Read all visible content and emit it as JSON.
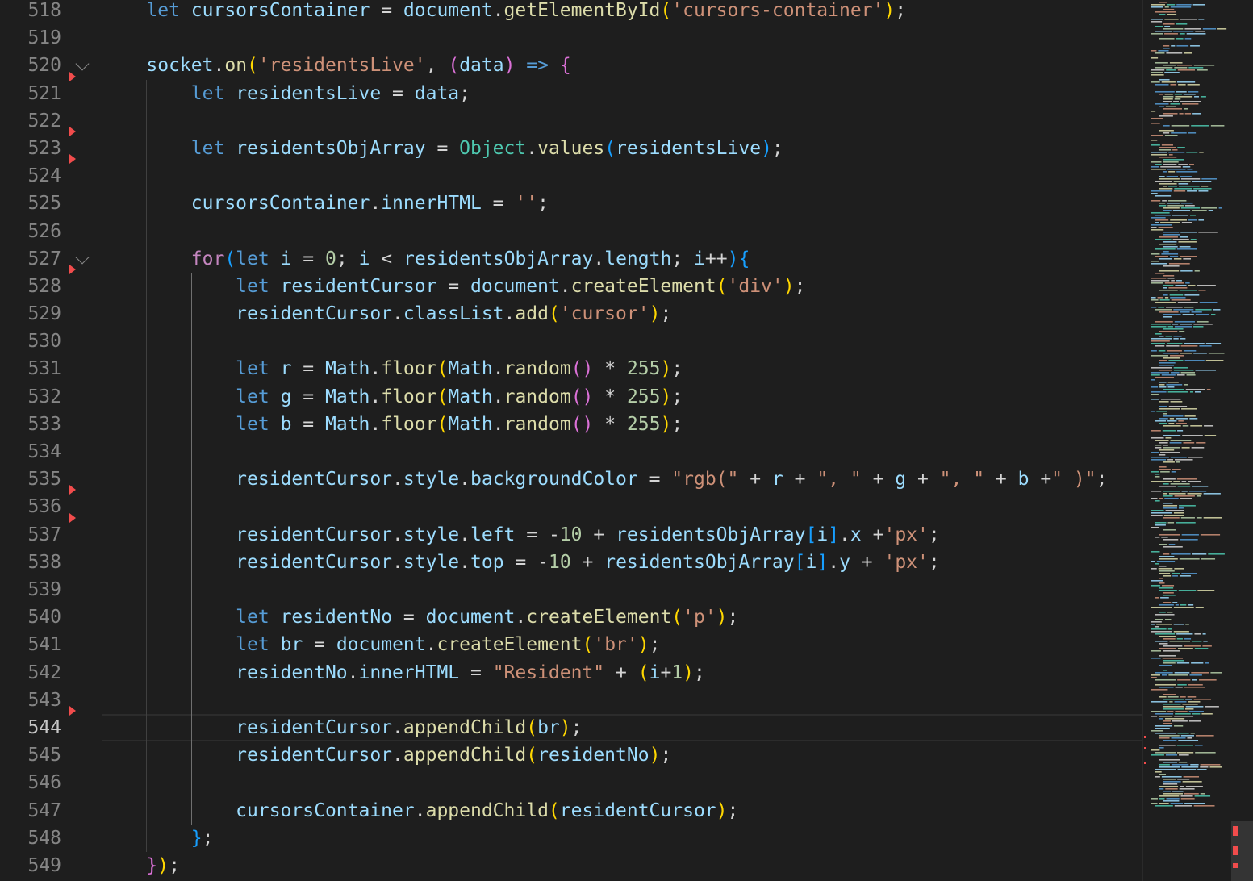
{
  "editor": {
    "first_line": 518,
    "active_line": 544,
    "folded_lines": [
      520,
      527
    ],
    "error_markers": [
      521,
      523,
      524,
      528,
      536,
      537,
      544
    ],
    "lines": [
      {
        "n": 518,
        "tokens": [
          [
            "    ",
            "pu"
          ],
          [
            "let",
            "kw"
          ],
          [
            " ",
            "pu"
          ],
          [
            "cursorsContainer",
            "var"
          ],
          [
            " = ",
            "op"
          ],
          [
            "document",
            "var"
          ],
          [
            ".",
            "pu"
          ],
          [
            "getElementById",
            "fn"
          ],
          [
            "(",
            "b1"
          ],
          [
            "'cursors-container'",
            "str"
          ],
          [
            ")",
            "b1"
          ],
          [
            ";",
            "pu"
          ]
        ]
      },
      {
        "n": 519,
        "tokens": []
      },
      {
        "n": 520,
        "tokens": [
          [
            "    ",
            "pu"
          ],
          [
            "socket",
            "var"
          ],
          [
            ".",
            "pu"
          ],
          [
            "on",
            "fn"
          ],
          [
            "(",
            "b1"
          ],
          [
            "'residentsLive'",
            "str"
          ],
          [
            ", ",
            "pu"
          ],
          [
            "(",
            "b2"
          ],
          [
            "data",
            "var"
          ],
          [
            ")",
            "b2"
          ],
          [
            " ",
            "pu"
          ],
          [
            "=>",
            "kw"
          ],
          [
            " ",
            "pu"
          ],
          [
            "{",
            "b2"
          ]
        ]
      },
      {
        "n": 521,
        "tokens": [
          [
            "        ",
            "pu"
          ],
          [
            "let",
            "kw"
          ],
          [
            " ",
            "pu"
          ],
          [
            "residentsLive",
            "var"
          ],
          [
            " = ",
            "op"
          ],
          [
            "data",
            "var"
          ],
          [
            ";",
            "pu"
          ]
        ]
      },
      {
        "n": 522,
        "tokens": []
      },
      {
        "n": 523,
        "tokens": [
          [
            "        ",
            "pu"
          ],
          [
            "let",
            "kw"
          ],
          [
            " ",
            "pu"
          ],
          [
            "residentsObjArray",
            "var"
          ],
          [
            " = ",
            "op"
          ],
          [
            "Object",
            "cls"
          ],
          [
            ".",
            "pu"
          ],
          [
            "values",
            "fn"
          ],
          [
            "(",
            "b3"
          ],
          [
            "residentsLive",
            "var"
          ],
          [
            ")",
            "b3"
          ],
          [
            ";",
            "pu"
          ]
        ]
      },
      {
        "n": 524,
        "tokens": []
      },
      {
        "n": 525,
        "tokens": [
          [
            "        ",
            "pu"
          ],
          [
            "cursorsContainer",
            "var"
          ],
          [
            ".",
            "pu"
          ],
          [
            "innerHTML",
            "var"
          ],
          [
            " = ",
            "op"
          ],
          [
            "''",
            "str"
          ],
          [
            ";",
            "pu"
          ]
        ]
      },
      {
        "n": 526,
        "tokens": []
      },
      {
        "n": 527,
        "tokens": [
          [
            "        ",
            "pu"
          ],
          [
            "for",
            "ctl"
          ],
          [
            "(",
            "b3"
          ],
          [
            "let",
            "kw"
          ],
          [
            " ",
            "pu"
          ],
          [
            "i",
            "var"
          ],
          [
            " = ",
            "op"
          ],
          [
            "0",
            "num"
          ],
          [
            "; ",
            "pu"
          ],
          [
            "i",
            "var"
          ],
          [
            " < ",
            "op"
          ],
          [
            "residentsObjArray",
            "var"
          ],
          [
            ".",
            "pu"
          ],
          [
            "length",
            "var"
          ],
          [
            "; ",
            "pu"
          ],
          [
            "i",
            "var"
          ],
          [
            "++",
            "op"
          ],
          [
            ")",
            "b3"
          ],
          [
            "{",
            "b3"
          ]
        ]
      },
      {
        "n": 528,
        "tokens": [
          [
            "            ",
            "pu"
          ],
          [
            "let",
            "kw"
          ],
          [
            " ",
            "pu"
          ],
          [
            "residentCursor",
            "var"
          ],
          [
            " = ",
            "op"
          ],
          [
            "document",
            "var"
          ],
          [
            ".",
            "pu"
          ],
          [
            "createElement",
            "fn"
          ],
          [
            "(",
            "b1"
          ],
          [
            "'div'",
            "str"
          ],
          [
            ")",
            "b1"
          ],
          [
            ";",
            "pu"
          ]
        ]
      },
      {
        "n": 529,
        "tokens": [
          [
            "            ",
            "pu"
          ],
          [
            "residentCursor",
            "var"
          ],
          [
            ".",
            "pu"
          ],
          [
            "classList",
            "var"
          ],
          [
            ".",
            "pu"
          ],
          [
            "add",
            "fn"
          ],
          [
            "(",
            "b1"
          ],
          [
            "'cursor'",
            "str"
          ],
          [
            ")",
            "b1"
          ],
          [
            ";",
            "pu"
          ]
        ]
      },
      {
        "n": 530,
        "tokens": []
      },
      {
        "n": 531,
        "tokens": [
          [
            "            ",
            "pu"
          ],
          [
            "let",
            "kw"
          ],
          [
            " ",
            "pu"
          ],
          [
            "r",
            "var"
          ],
          [
            " = ",
            "op"
          ],
          [
            "Math",
            "var"
          ],
          [
            ".",
            "pu"
          ],
          [
            "floor",
            "fn"
          ],
          [
            "(",
            "b1"
          ],
          [
            "Math",
            "var"
          ],
          [
            ".",
            "pu"
          ],
          [
            "random",
            "fn"
          ],
          [
            "()",
            "b2"
          ],
          [
            " * ",
            "op"
          ],
          [
            "255",
            "num"
          ],
          [
            ")",
            "b1"
          ],
          [
            ";",
            "pu"
          ]
        ]
      },
      {
        "n": 532,
        "tokens": [
          [
            "            ",
            "pu"
          ],
          [
            "let",
            "kw"
          ],
          [
            " ",
            "pu"
          ],
          [
            "g",
            "var"
          ],
          [
            " = ",
            "op"
          ],
          [
            "Math",
            "var"
          ],
          [
            ".",
            "pu"
          ],
          [
            "floor",
            "fn"
          ],
          [
            "(",
            "b1"
          ],
          [
            "Math",
            "var"
          ],
          [
            ".",
            "pu"
          ],
          [
            "random",
            "fn"
          ],
          [
            "()",
            "b2"
          ],
          [
            " * ",
            "op"
          ],
          [
            "255",
            "num"
          ],
          [
            ")",
            "b1"
          ],
          [
            ";",
            "pu"
          ]
        ]
      },
      {
        "n": 533,
        "tokens": [
          [
            "            ",
            "pu"
          ],
          [
            "let",
            "kw"
          ],
          [
            " ",
            "pu"
          ],
          [
            "b",
            "var"
          ],
          [
            " = ",
            "op"
          ],
          [
            "Math",
            "var"
          ],
          [
            ".",
            "pu"
          ],
          [
            "floor",
            "fn"
          ],
          [
            "(",
            "b1"
          ],
          [
            "Math",
            "var"
          ],
          [
            ".",
            "pu"
          ],
          [
            "random",
            "fn"
          ],
          [
            "()",
            "b2"
          ],
          [
            " * ",
            "op"
          ],
          [
            "255",
            "num"
          ],
          [
            ")",
            "b1"
          ],
          [
            ";",
            "pu"
          ]
        ]
      },
      {
        "n": 534,
        "tokens": []
      },
      {
        "n": 535,
        "tokens": [
          [
            "            ",
            "pu"
          ],
          [
            "residentCursor",
            "var"
          ],
          [
            ".",
            "pu"
          ],
          [
            "style",
            "var"
          ],
          [
            ".",
            "pu"
          ],
          [
            "backgroundColor",
            "var"
          ],
          [
            " = ",
            "op"
          ],
          [
            "\"rgb(\"",
            "str"
          ],
          [
            " + ",
            "op"
          ],
          [
            "r",
            "var"
          ],
          [
            " + ",
            "op"
          ],
          [
            "\", \"",
            "str"
          ],
          [
            " + ",
            "op"
          ],
          [
            "g",
            "var"
          ],
          [
            " + ",
            "op"
          ],
          [
            "\", \"",
            "str"
          ],
          [
            " + ",
            "op"
          ],
          [
            "b",
            "var"
          ],
          [
            " +",
            "op"
          ],
          [
            "\" )\"",
            "str"
          ],
          [
            ";",
            "pu"
          ]
        ]
      },
      {
        "n": 536,
        "tokens": []
      },
      {
        "n": 537,
        "tokens": [
          [
            "            ",
            "pu"
          ],
          [
            "residentCursor",
            "var"
          ],
          [
            ".",
            "pu"
          ],
          [
            "style",
            "var"
          ],
          [
            ".",
            "pu"
          ],
          [
            "left",
            "var"
          ],
          [
            " = ",
            "op"
          ],
          [
            "-",
            "op"
          ],
          [
            "10",
            "num"
          ],
          [
            " + ",
            "op"
          ],
          [
            "residentsObjArray",
            "var"
          ],
          [
            "[",
            "b3"
          ],
          [
            "i",
            "var"
          ],
          [
            "]",
            "b3"
          ],
          [
            ".",
            "pu"
          ],
          [
            "x",
            "var"
          ],
          [
            " +",
            "op"
          ],
          [
            "'px'",
            "str"
          ],
          [
            ";",
            "pu"
          ]
        ]
      },
      {
        "n": 538,
        "tokens": [
          [
            "            ",
            "pu"
          ],
          [
            "residentCursor",
            "var"
          ],
          [
            ".",
            "pu"
          ],
          [
            "style",
            "var"
          ],
          [
            ".",
            "pu"
          ],
          [
            "top",
            "var"
          ],
          [
            " = ",
            "op"
          ],
          [
            "-",
            "op"
          ],
          [
            "10",
            "num"
          ],
          [
            " + ",
            "op"
          ],
          [
            "residentsObjArray",
            "var"
          ],
          [
            "[",
            "b3"
          ],
          [
            "i",
            "var"
          ],
          [
            "]",
            "b3"
          ],
          [
            ".",
            "pu"
          ],
          [
            "y",
            "var"
          ],
          [
            " + ",
            "op"
          ],
          [
            "'px'",
            "str"
          ],
          [
            ";",
            "pu"
          ]
        ]
      },
      {
        "n": 539,
        "tokens": []
      },
      {
        "n": 540,
        "tokens": [
          [
            "            ",
            "pu"
          ],
          [
            "let",
            "kw"
          ],
          [
            " ",
            "pu"
          ],
          [
            "residentNo",
            "var"
          ],
          [
            " = ",
            "op"
          ],
          [
            "document",
            "var"
          ],
          [
            ".",
            "pu"
          ],
          [
            "createElement",
            "fn"
          ],
          [
            "(",
            "b1"
          ],
          [
            "'p'",
            "str"
          ],
          [
            ")",
            "b1"
          ],
          [
            ";",
            "pu"
          ]
        ]
      },
      {
        "n": 541,
        "tokens": [
          [
            "            ",
            "pu"
          ],
          [
            "let",
            "kw"
          ],
          [
            " ",
            "pu"
          ],
          [
            "br",
            "var"
          ],
          [
            " = ",
            "op"
          ],
          [
            "document",
            "var"
          ],
          [
            ".",
            "pu"
          ],
          [
            "createElement",
            "fn"
          ],
          [
            "(",
            "b1"
          ],
          [
            "'br'",
            "str"
          ],
          [
            ")",
            "b1"
          ],
          [
            ";",
            "pu"
          ]
        ]
      },
      {
        "n": 542,
        "tokens": [
          [
            "            ",
            "pu"
          ],
          [
            "residentNo",
            "var"
          ],
          [
            ".",
            "pu"
          ],
          [
            "innerHTML",
            "var"
          ],
          [
            " = ",
            "op"
          ],
          [
            "\"Resident\"",
            "str"
          ],
          [
            " + ",
            "op"
          ],
          [
            "(",
            "b1"
          ],
          [
            "i",
            "var"
          ],
          [
            "+",
            "op"
          ],
          [
            "1",
            "num"
          ],
          [
            ")",
            "b1"
          ],
          [
            ";",
            "pu"
          ]
        ]
      },
      {
        "n": 543,
        "tokens": []
      },
      {
        "n": 544,
        "tokens": [
          [
            "            ",
            "pu"
          ],
          [
            "residentCursor",
            "var"
          ],
          [
            ".",
            "pu"
          ],
          [
            "appendChild",
            "fn"
          ],
          [
            "(",
            "b1"
          ],
          [
            "br",
            "var"
          ],
          [
            ")",
            "b1"
          ],
          [
            ";",
            "pu"
          ]
        ]
      },
      {
        "n": 545,
        "tokens": [
          [
            "            ",
            "pu"
          ],
          [
            "residentCursor",
            "var"
          ],
          [
            ".",
            "pu"
          ],
          [
            "appendChild",
            "fn"
          ],
          [
            "(",
            "b1"
          ],
          [
            "residentNo",
            "var"
          ],
          [
            ")",
            "b1"
          ],
          [
            ";",
            "pu"
          ]
        ]
      },
      {
        "n": 546,
        "tokens": []
      },
      {
        "n": 547,
        "tokens": [
          [
            "            ",
            "pu"
          ],
          [
            "cursorsContainer",
            "var"
          ],
          [
            ".",
            "pu"
          ],
          [
            "appendChild",
            "fn"
          ],
          [
            "(",
            "b1"
          ],
          [
            "residentCursor",
            "var"
          ],
          [
            ")",
            "b1"
          ],
          [
            ";",
            "pu"
          ]
        ]
      },
      {
        "n": 548,
        "tokens": [
          [
            "        ",
            "pu"
          ],
          [
            "}",
            "b3"
          ],
          [
            ";",
            "pu"
          ]
        ]
      },
      {
        "n": 549,
        "tokens": [
          [
            "    ",
            "pu"
          ],
          [
            "}",
            "b2"
          ],
          [
            ")",
            "b1"
          ],
          [
            ";",
            "pu"
          ]
        ]
      }
    ]
  },
  "colors": {
    "background": "#1e1e1e",
    "line_number": "#858585",
    "line_number_active": "#c6c6c6",
    "error": "#f14c4c"
  },
  "icons": {
    "fold": "chevron-down-icon",
    "error_marker": "error-triangle-icon"
  }
}
